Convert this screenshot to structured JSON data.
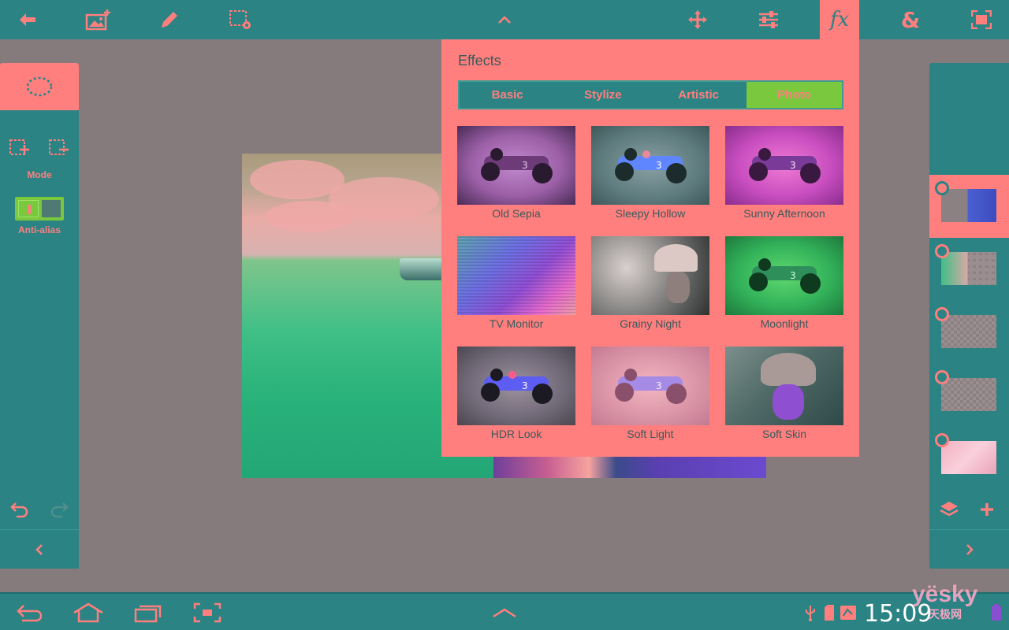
{
  "toolbar": {
    "icons": [
      "back-arrow-icon",
      "add-image-icon",
      "pencil-icon",
      "selection-settings-icon",
      "chevron-up-icon",
      "move-icon",
      "sliders-icon",
      "fx-icon",
      "ampersand-icon",
      "fit-screen-icon"
    ],
    "fx_label": "fx",
    "amp_label": "&"
  },
  "left_panel": {
    "mode_label": "Mode",
    "antialias_label": "Anti-alias",
    "antialias_on": true
  },
  "effects": {
    "title": "Effects",
    "tabs": [
      {
        "label": "Basic",
        "active": false
      },
      {
        "label": "Stylize",
        "active": false
      },
      {
        "label": "Artistic",
        "active": false
      },
      {
        "label": "Photo",
        "active": true
      }
    ],
    "items": [
      {
        "label": "Old Sepia"
      },
      {
        "label": "Sleepy Hollow"
      },
      {
        "label": "Sunny Afternoon"
      },
      {
        "label": "TV Monitor"
      },
      {
        "label": "Grainy Night"
      },
      {
        "label": "Moonlight"
      },
      {
        "label": "HDR Look"
      },
      {
        "label": "Soft Light"
      },
      {
        "label": "Soft Skin"
      }
    ]
  },
  "layers": {
    "count": 5,
    "selected_index": 0
  },
  "statusbar": {
    "time": "15:09",
    "watermark": "yësky",
    "watermark_sub": "天极网"
  },
  "colors": {
    "bar": "#2b8384",
    "accent": "#ff7f7e",
    "active_tab": "#7ac83d",
    "background": "#857b7c"
  }
}
